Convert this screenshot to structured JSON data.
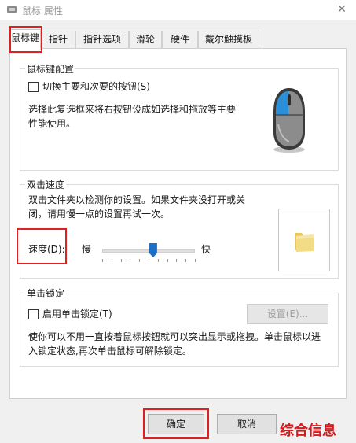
{
  "window": {
    "title": "鼠标 属性",
    "close_glyph": "✕"
  },
  "tabs": [
    {
      "label": "鼠标键",
      "active": true
    },
    {
      "label": "指针",
      "active": false
    },
    {
      "label": "指针选项",
      "active": false
    },
    {
      "label": "滑轮",
      "active": false
    },
    {
      "label": "硬件",
      "active": false
    },
    {
      "label": "戴尔触摸板",
      "active": false
    }
  ],
  "button_config": {
    "group_title": "鼠标键配置",
    "switch_label": "切换主要和次要的按钮(S)",
    "switch_checked": false,
    "description_line1": "选择此复选框来将右按钮设成如选择和拖放等主要",
    "description_line2": "性能使用。",
    "icon": "mouse-icon"
  },
  "double_click": {
    "group_title": "双击速度",
    "description_line1": "双击文件夹以检测你的设置。如果文件夹没打开或关",
    "description_line2": "闭，请用慢一点的设置再试一次。",
    "speed_label": "速度(D):",
    "slow_label": "慢",
    "fast_label": "快",
    "speed_fraction": 0.55,
    "test_icon": "folder-icon"
  },
  "click_lock": {
    "group_title": "单击锁定",
    "enable_label": "启用单击锁定(T)",
    "enable_checked": false,
    "settings_label": "设置(E)...",
    "description_line1": "使你可以不用一直按着鼠标按钮就可以突出显示或拖拽。单击鼠标以进",
    "description_line2": "入锁定状态,再次单击鼠标可解除锁定。"
  },
  "footer": {
    "ok_label": "确定",
    "cancel_label": "取消"
  },
  "watermark": "综合信息",
  "colors": {
    "highlight": "#e02020",
    "slider_thumb": "#1e6fc8",
    "mouse_accent": "#2a8fd6"
  }
}
